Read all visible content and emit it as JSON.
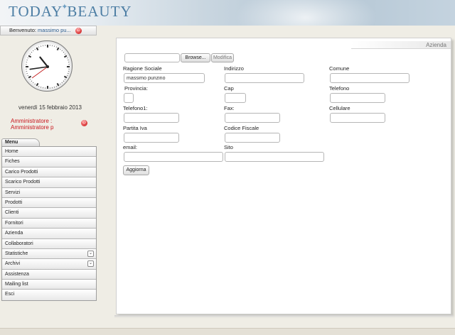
{
  "header": {
    "logo_part1": "TODAY",
    "logo_part2": "BEAUTY",
    "logo_color": "#4d7ea4"
  },
  "welcome": {
    "prefix": "Benvenuto:",
    "user": "massimo pu...",
    "logout_icon": "power-icon"
  },
  "clock": {
    "hours": 10,
    "minutes": 43,
    "seconds": 39
  },
  "date": "venerdì 15 febbraio 2013",
  "role": {
    "line1": "Amministratore :",
    "line2": "Amministratore p"
  },
  "menu": {
    "tab_label": "Menu",
    "items": [
      {
        "label": "Home",
        "has_chevron": false
      },
      {
        "label": "Fiches",
        "has_chevron": false
      },
      {
        "label": "Carico Prodotti",
        "has_chevron": false
      },
      {
        "label": "Scarico Prodotti",
        "has_chevron": false
      },
      {
        "label": "Servizi",
        "has_chevron": false
      },
      {
        "label": "Prodotti",
        "has_chevron": false
      },
      {
        "label": "Clienti",
        "has_chevron": false
      },
      {
        "label": "Fornitori",
        "has_chevron": false
      },
      {
        "label": "Azienda",
        "has_chevron": false
      },
      {
        "label": "Collaboratori",
        "has_chevron": false
      },
      {
        "label": "Statistiche",
        "has_chevron": true
      },
      {
        "label": "Archivi",
        "has_chevron": true
      },
      {
        "label": "Assistenza",
        "has_chevron": false
      },
      {
        "label": "Mailing list",
        "has_chevron": false
      },
      {
        "label": "Esci",
        "has_chevron": false
      }
    ]
  },
  "panel": {
    "title": "Azienda",
    "browse_label": "Browse...",
    "modifica_label": "Modifica",
    "aggiorna_label": "Aggiorna",
    "fields": {
      "ragione_sociale": {
        "label": "Ragione Sociale",
        "value": "massimo punzino"
      },
      "indirizzo": {
        "label": "Indirizzo",
        "value": ""
      },
      "comune": {
        "label": "Comune",
        "value": ""
      },
      "provincia": {
        "label": "Provincia:",
        "value": ""
      },
      "cap": {
        "label": "Cap",
        "value": ""
      },
      "telefono": {
        "label": "Telefono",
        "value": ""
      },
      "telefono1": {
        "label": "Telefono1:",
        "value": ""
      },
      "fax": {
        "label": "Fax:",
        "value": ""
      },
      "cellulare": {
        "label": "Cellulare",
        "value": ""
      },
      "partita_iva": {
        "label": "Partita Iva",
        "value": ""
      },
      "codice_fiscale": {
        "label": "Codice Fiscale",
        "value": ""
      },
      "email": {
        "label": "email:",
        "value": ""
      },
      "sito": {
        "label": "Sito",
        "value": ""
      }
    }
  }
}
